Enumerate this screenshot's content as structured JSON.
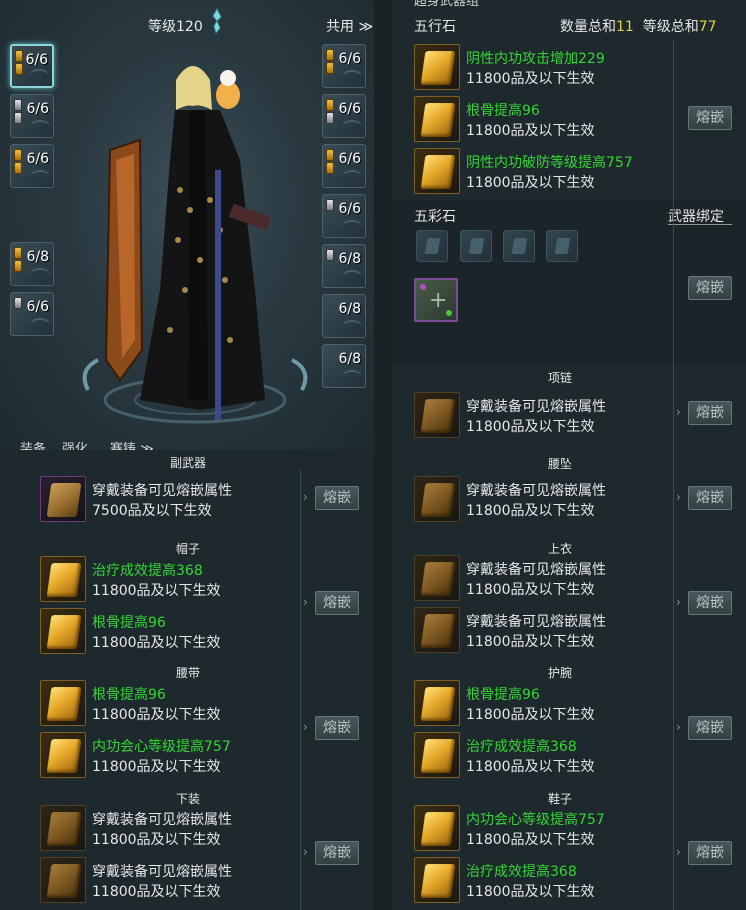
{
  "character": {
    "level_label": "等级120",
    "shared_label": "共用 ≫",
    "left_slots": [
      {
        "count": "6/6",
        "gems": [
          "gold",
          "gold"
        ],
        "selected": true
      },
      {
        "count": "6/6",
        "gems": [
          "gray",
          "gray"
        ],
        "selected": false
      },
      {
        "count": "6/6",
        "gems": [
          "gold",
          "gold"
        ],
        "selected": false
      },
      {
        "count": "6/8",
        "gems": [
          "gold",
          "gold"
        ],
        "selected": false
      },
      {
        "count": "6/6",
        "gems": [
          "gray"
        ],
        "selected": false
      }
    ],
    "right_slots": [
      {
        "count": "6/6",
        "gems": [
          "gold",
          "gold"
        ]
      },
      {
        "count": "6/6",
        "gems": [
          "gold",
          "gray"
        ]
      },
      {
        "count": "6/6",
        "gems": [
          "gold",
          "gold"
        ]
      },
      {
        "count": "6/6",
        "gems": [
          "gray"
        ]
      },
      {
        "count": "6/8",
        "gems": [
          "gray"
        ]
      },
      {
        "count": "6/8",
        "gems": []
      },
      {
        "count": "6/8",
        "gems": []
      }
    ],
    "tabs": [
      "装备",
      "强化",
      "赛铸 ≫"
    ]
  },
  "five_element": {
    "header_title": "五行石",
    "count_label": "数量总和",
    "count_value": "11",
    "level_label": "等级总和",
    "level_value": "77",
    "top_cut_title": "超身武器组",
    "rows": [
      {
        "effect": "阴性内功攻击增加229",
        "req": "11800品及以下生效"
      },
      {
        "effect": "根骨提高96",
        "req": "11800品及以下生效"
      },
      {
        "effect": "阴性内功破防等级提高757",
        "req": "11800品及以下生效"
      }
    ],
    "inlay": "熔嵌"
  },
  "wucai": {
    "title": "五彩石",
    "bind": "武器绑定",
    "inlay": "熔嵌"
  },
  "sections_left": [
    {
      "title": "副武器",
      "rows": [
        {
          "effect": "穿戴装备可见熔嵌属性",
          "req": "7500品及以下生效",
          "green": false,
          "icon": "purple"
        }
      ],
      "inlay": "熔嵌"
    },
    {
      "title": "帽子",
      "rows": [
        {
          "effect": "治疗成效提高368",
          "req": "11800品及以下生效",
          "green": true,
          "icon": "gold"
        },
        {
          "effect": "根骨提高96",
          "req": "11800品及以下生效",
          "green": true,
          "icon": "gold"
        }
      ],
      "inlay": "熔嵌"
    },
    {
      "title": "腰带",
      "rows": [
        {
          "effect": "根骨提高96",
          "req": "11800品及以下生效",
          "green": true,
          "icon": "gold"
        },
        {
          "effect": "内功会心等级提高757",
          "req": "11800品及以下生效",
          "green": true,
          "icon": "gold"
        }
      ],
      "inlay": "熔嵌"
    },
    {
      "title": "下装",
      "rows": [
        {
          "effect": "穿戴装备可见熔嵌属性",
          "req": "11800品及以下生效",
          "green": false,
          "icon": "dim"
        },
        {
          "effect": "穿戴装备可见熔嵌属性",
          "req": "11800品及以下生效",
          "green": false,
          "icon": "dim"
        }
      ],
      "inlay": "熔嵌"
    }
  ],
  "sections_right": [
    {
      "title": "项链",
      "rows": [
        {
          "effect": "穿戴装备可见熔嵌属性",
          "req": "11800品及以下生效",
          "green": false,
          "icon": "dim"
        }
      ],
      "inlay": "熔嵌"
    },
    {
      "title": "腰坠",
      "rows": [
        {
          "effect": "穿戴装备可见熔嵌属性",
          "req": "11800品及以下生效",
          "green": false,
          "icon": "dim"
        }
      ],
      "inlay": "熔嵌"
    },
    {
      "title": "上衣",
      "rows": [
        {
          "effect": "穿戴装备可见熔嵌属性",
          "req": "11800品及以下生效",
          "green": false,
          "icon": "dim"
        },
        {
          "effect": "穿戴装备可见熔嵌属性",
          "req": "11800品及以下生效",
          "green": false,
          "icon": "dim"
        }
      ],
      "inlay": "熔嵌"
    },
    {
      "title": "护腕",
      "rows": [
        {
          "effect": "根骨提高96",
          "req": "11800品及以下生效",
          "green": true,
          "icon": "gold"
        },
        {
          "effect": "治疗成效提高368",
          "req": "11800品及以下生效",
          "green": true,
          "icon": "gold"
        }
      ],
      "inlay": "熔嵌"
    },
    {
      "title": "鞋子",
      "rows": [
        {
          "effect": "内功会心等级提高757",
          "req": "11800品及以下生效",
          "green": true,
          "icon": "gold"
        },
        {
          "effect": "治疗成效提高368",
          "req": "11800品及以下生效",
          "green": true,
          "icon": "gold"
        }
      ],
      "inlay": "熔嵌"
    }
  ]
}
